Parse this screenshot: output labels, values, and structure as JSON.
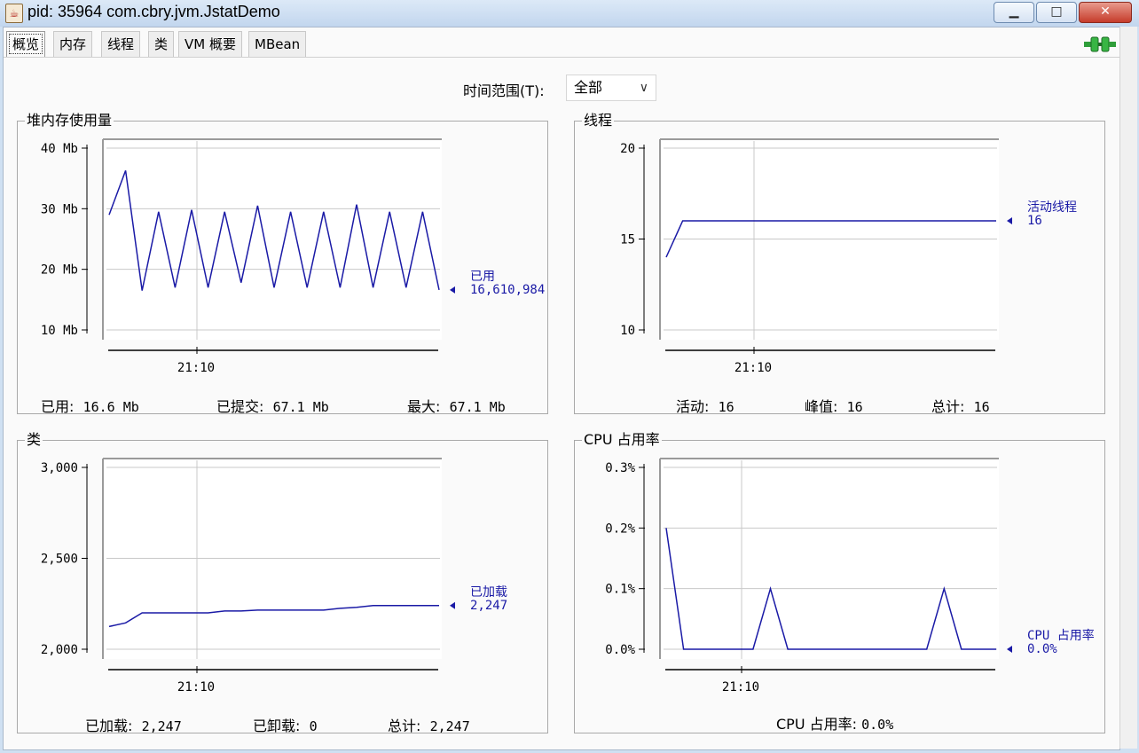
{
  "window": {
    "title": "pid: 35964 com.cbry.jvm.JstatDemo"
  },
  "tabs": [
    "概览",
    "内存",
    "线程",
    "类",
    "VM 概要",
    "MBean"
  ],
  "time_range": {
    "label": "时间范围(T):",
    "value": "全部"
  },
  "colors": {
    "series": "#1a1aa6",
    "grid": "#c8c8c8",
    "plot_bg": "#ffffff"
  },
  "heap": {
    "title": "堆内存使用量",
    "legend_label": "已用",
    "legend_value": "16,610,984",
    "footer": [
      {
        "label": "已用:",
        "value": "16.6  Mb"
      },
      {
        "label": "已提交:",
        "value": "67.1  Mb"
      },
      {
        "label": "最大:",
        "value": "67.1  Mb"
      }
    ]
  },
  "threads": {
    "title": "线程",
    "legend_label": "活动线程",
    "legend_value": "16",
    "footer": [
      {
        "label": "活动:",
        "value": "16"
      },
      {
        "label": "峰值:",
        "value": "16"
      },
      {
        "label": "总计:",
        "value": "16"
      }
    ]
  },
  "classes": {
    "title": "类",
    "legend_label": "已加载",
    "legend_value": "2,247",
    "footer": [
      {
        "label": "已加载:",
        "value": "2,247"
      },
      {
        "label": "已卸载:",
        "value": "0"
      },
      {
        "label": "总计:",
        "value": "2,247"
      }
    ]
  },
  "cpu": {
    "title": "CPU 占用率",
    "legend_label": "CPU 占用率",
    "legend_value": "0.0%",
    "footer": [
      {
        "label": "CPU 占用率:",
        "value": "0.0%"
      }
    ]
  },
  "chart_data": [
    {
      "type": "line",
      "title": "堆内存使用量",
      "y_ticks": [
        "10 Mb",
        "20 Mb",
        "30 Mb",
        "40 Mb"
      ],
      "y_tick_values": [
        10,
        20,
        30,
        40
      ],
      "ylim": [
        10,
        40
      ],
      "x_tick_labels": [
        "21:10"
      ],
      "series": [
        {
          "name": "已用",
          "values": [
            29,
            36.3,
            16.5,
            29.5,
            17,
            29.8,
            17,
            29.5,
            17.8,
            30.5,
            17,
            29.5,
            17,
            29.5,
            17,
            30.7,
            17,
            29.5,
            17,
            29.5,
            16.6
          ]
        }
      ]
    },
    {
      "type": "line",
      "title": "线程",
      "y_ticks": [
        "10",
        "15",
        "20"
      ],
      "y_tick_values": [
        10,
        15,
        20
      ],
      "ylim": [
        10,
        20
      ],
      "x_tick_labels": [
        "21:10"
      ],
      "series": [
        {
          "name": "活动线程",
          "values": [
            14,
            16,
            16,
            16,
            16,
            16,
            16,
            16,
            16,
            16,
            16,
            16,
            16,
            16,
            16,
            16,
            16,
            16,
            16,
            16,
            16
          ]
        }
      ]
    },
    {
      "type": "line",
      "title": "类",
      "y_ticks": [
        "2,000",
        "2,500",
        "3,000"
      ],
      "y_tick_values": [
        2000,
        2500,
        3000
      ],
      "ylim": [
        2000,
        3000
      ],
      "x_tick_labels": [
        "21:10"
      ],
      "series": [
        {
          "name": "已加载",
          "values": [
            2125,
            2145,
            2200,
            2200,
            2200,
            2200,
            2200,
            2210,
            2210,
            2215,
            2215,
            2215,
            2215,
            2215,
            2225,
            2230,
            2240,
            2240,
            2240,
            2240,
            2240
          ]
        }
      ]
    },
    {
      "type": "line",
      "title": "CPU 占用率",
      "y_ticks": [
        "0.0%",
        "0.1%",
        "0.2%",
        "0.3%"
      ],
      "y_tick_values": [
        0,
        0.1,
        0.2,
        0.3
      ],
      "ylim": [
        0,
        0.3
      ],
      "x_tick_labels": [
        "21:10"
      ],
      "series": [
        {
          "name": "CPU 占用率",
          "values": [
            0.2,
            0,
            0,
            0,
            0,
            0,
            0.1,
            0,
            0,
            0,
            0,
            0,
            0,
            0,
            0,
            0,
            0.1,
            0,
            0,
            0
          ]
        }
      ]
    }
  ]
}
